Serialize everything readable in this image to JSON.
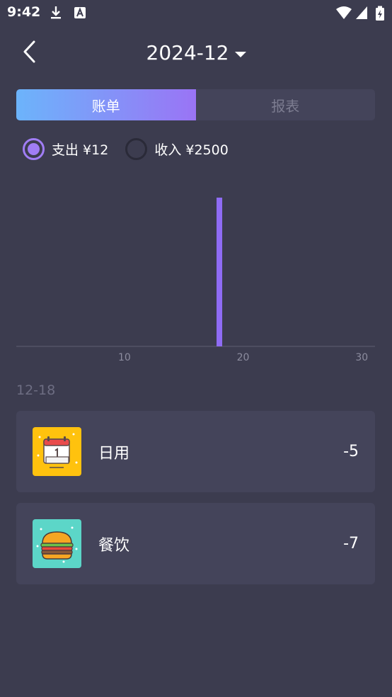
{
  "status": {
    "time": "9:42"
  },
  "header": {
    "month": "2024-12"
  },
  "tabs": [
    {
      "label": "账单",
      "active": true
    },
    {
      "label": "报表",
      "active": false
    }
  ],
  "filters": [
    {
      "label": "支出 ¥12",
      "checked": true
    },
    {
      "label": "收入 ¥2500",
      "checked": false
    }
  ],
  "chart_data": {
    "type": "bar",
    "x": [
      18
    ],
    "values": [
      12
    ],
    "x_ticks": [
      "10",
      "20",
      "30"
    ],
    "xlim": [
      1,
      31
    ],
    "bar_color": "#8f6cf5",
    "grid": false
  },
  "list": {
    "date": "12-18",
    "items": [
      {
        "name": "日用",
        "amount": "-5",
        "icon": "daily-calendar-icon",
        "icon_bg": "#ffc20e"
      },
      {
        "name": "餐饮",
        "amount": "-7",
        "icon": "burger-icon",
        "icon_bg": "#5cd6c8"
      }
    ]
  },
  "colors": {
    "background": "#3c3c4f",
    "card": "#44445a",
    "accent": "#9a74f5"
  }
}
